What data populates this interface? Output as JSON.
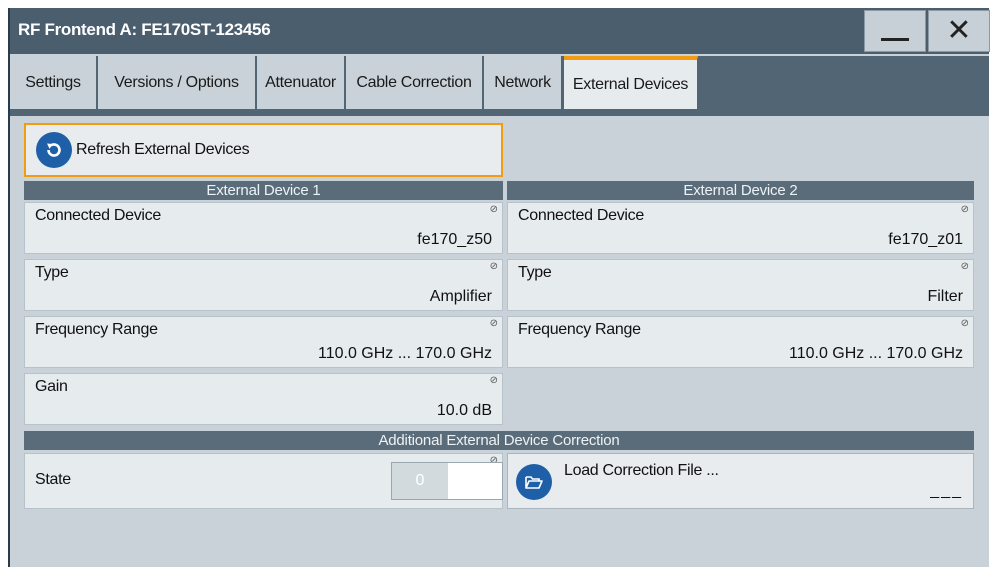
{
  "window": {
    "title": "RF Frontend A: FE170ST-123456"
  },
  "tabs": [
    {
      "label": "Settings"
    },
    {
      "label": "Versions / Options"
    },
    {
      "label": "Attenuator"
    },
    {
      "label": "Cable Correction"
    },
    {
      "label": "Network"
    },
    {
      "label": "External Devices"
    }
  ],
  "active_tab": "External Devices",
  "refresh_button": {
    "label": "Refresh External Devices",
    "icon": "refresh-icon"
  },
  "device1": {
    "header": "External Device 1",
    "connected_device": {
      "label": "Connected Device",
      "value": "fe170_z50"
    },
    "type": {
      "label": "Type",
      "value": "Amplifier"
    },
    "frequency_range": {
      "label": "Frequency Range",
      "value": "110.0 GHz ... 170.0 GHz"
    },
    "gain": {
      "label": "Gain",
      "value": "10.0 dB"
    }
  },
  "device2": {
    "header": "External Device 2",
    "connected_device": {
      "label": "Connected Device",
      "value": "fe170_z01"
    },
    "type": {
      "label": "Type",
      "value": "Filter"
    },
    "frequency_range": {
      "label": "Frequency Range",
      "value": "110.0 GHz ... 170.0 GHz"
    }
  },
  "correction": {
    "header": "Additional External Device Correction",
    "state": {
      "label": "State",
      "toggle_value": "0"
    },
    "load_button": {
      "label": "Load Correction File ...",
      "value": "___",
      "icon": "folder-open-icon"
    }
  },
  "colors": {
    "accent": "#f39c12",
    "titlebar": "#4a5e6e",
    "icon_blue": "#1e5fa8"
  }
}
